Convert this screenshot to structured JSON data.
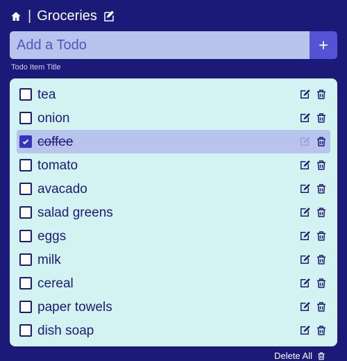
{
  "breadcrumb": {
    "list_title": "Groceries"
  },
  "input": {
    "placeholder": "Add a Todo",
    "helper": "Todo Item Title"
  },
  "items": [
    {
      "label": "tea",
      "done": false
    },
    {
      "label": "onion",
      "done": false
    },
    {
      "label": "coffee",
      "done": true
    },
    {
      "label": "tomato",
      "done": false
    },
    {
      "label": "avacado",
      "done": false
    },
    {
      "label": "salad greens",
      "done": false
    },
    {
      "label": "eggs",
      "done": false
    },
    {
      "label": "milk",
      "done": false
    },
    {
      "label": "cereal",
      "done": false
    },
    {
      "label": "paper towels",
      "done": false
    },
    {
      "label": "dish soap",
      "done": false
    }
  ],
  "footer": {
    "delete_all": "Delete All"
  }
}
